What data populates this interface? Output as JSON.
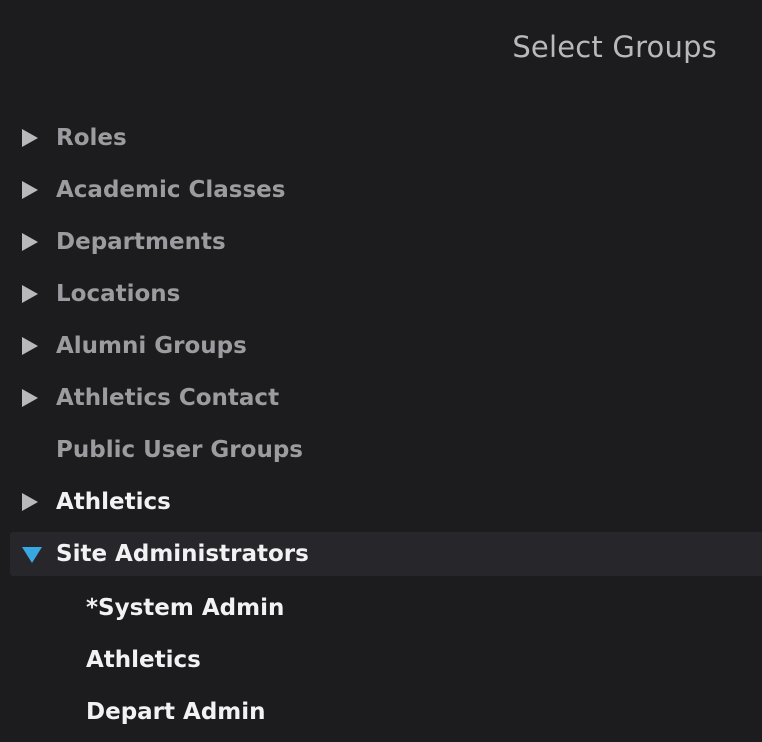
{
  "header": {
    "title": "Select Groups"
  },
  "tree": {
    "items": [
      {
        "label": "Roles",
        "toggle": "collapsed"
      },
      {
        "label": "Academic Classes",
        "toggle": "collapsed"
      },
      {
        "label": "Departments",
        "toggle": "collapsed"
      },
      {
        "label": "Locations",
        "toggle": "collapsed"
      },
      {
        "label": "Alumni Groups",
        "toggle": "collapsed"
      },
      {
        "label": "Athletics Contact",
        "toggle": "collapsed"
      },
      {
        "label": "Public User Groups",
        "toggle": "none"
      },
      {
        "label": "Athletics",
        "toggle": "collapsed"
      },
      {
        "label": "Site Administrators",
        "toggle": "expanded",
        "children": [
          {
            "label": "*System Admin"
          },
          {
            "label": "Athletics"
          },
          {
            "label": "Depart Admin"
          }
        ]
      }
    ]
  },
  "colors": {
    "background": "#1c1c1e",
    "expanded_row": "#27272b",
    "accent_triangle": "#3aa8e0",
    "muted_text": "#9c9ca0",
    "bright_text": "#f2f2f4"
  },
  "icons": {
    "collapsed": "caret-right-icon",
    "expanded": "caret-down-icon"
  }
}
